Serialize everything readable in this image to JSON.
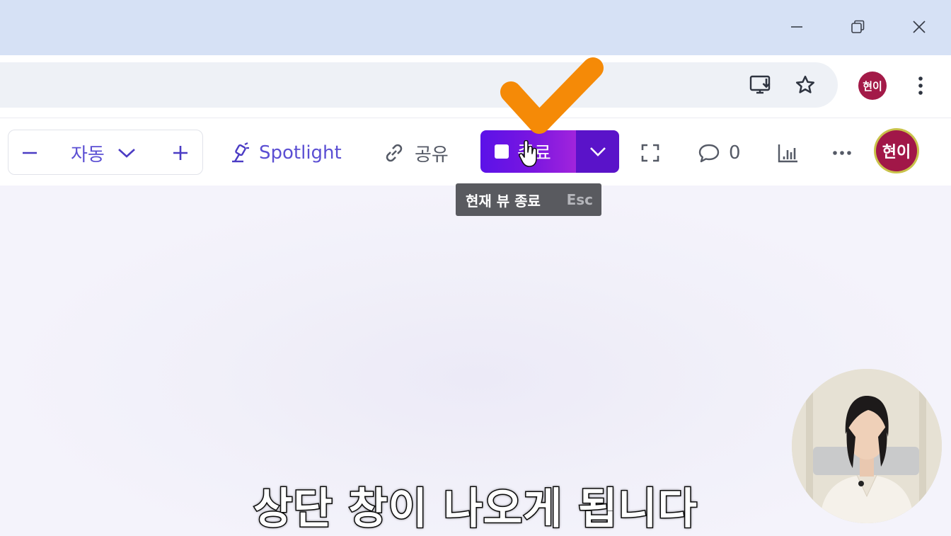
{
  "window_controls": {
    "minimize": "minimize-icon",
    "restore": "restore-icon",
    "close": "close-icon"
  },
  "browser": {
    "profile_initials": "현이",
    "icons": [
      "install-app-icon",
      "star-icon",
      "kebab-menu-icon"
    ]
  },
  "toolbar": {
    "zoom": {
      "minus_icon": "minus-icon",
      "label": "자동",
      "plus_icon": "plus-icon"
    },
    "spotlight_label": "Spotlight",
    "share_label": "공유",
    "end_button_label": "종료",
    "comment_count": "0",
    "avatar_initials": "현이"
  },
  "tooltip": {
    "text": "현재 뷰 종료",
    "shortcut": "Esc"
  },
  "subtitle": "상단 창이 나오게 됩니다",
  "colors": {
    "accent": "#5b4fd3",
    "end_button_start": "#5b12e8",
    "end_button_end": "#a124dc",
    "avatar": "#a11748",
    "checkmark": "#f58a07"
  }
}
